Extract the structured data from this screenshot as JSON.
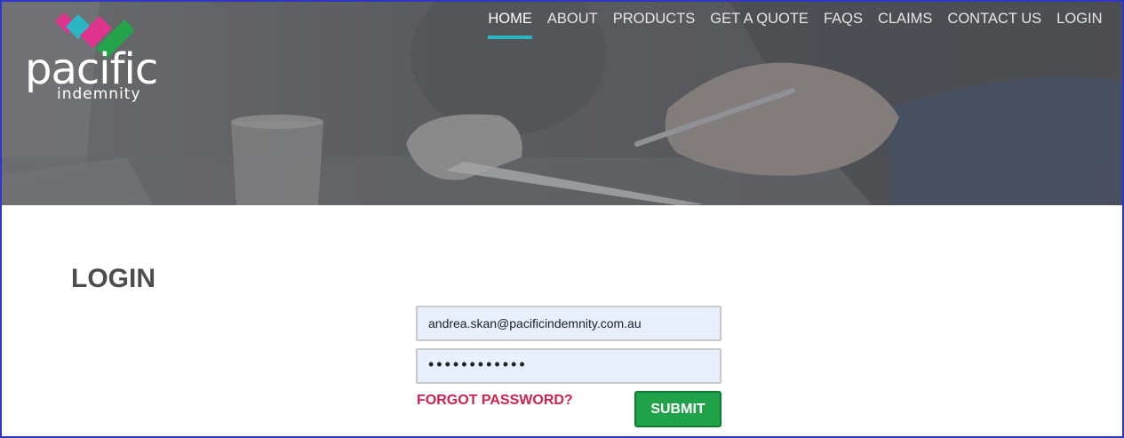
{
  "brand": {
    "name": "pacific",
    "subname": "indemnity",
    "colors": {
      "pink": "#e0338e",
      "teal": "#2cb5c4",
      "green": "#23a34a"
    }
  },
  "nav": {
    "items": [
      {
        "label": "HOME",
        "active": true
      },
      {
        "label": "ABOUT"
      },
      {
        "label": "PRODUCTS"
      },
      {
        "label": "GET A QUOTE"
      },
      {
        "label": "FAQS"
      },
      {
        "label": "CLAIMS"
      },
      {
        "label": "CONTACT US"
      },
      {
        "label": "LOGIN"
      }
    ]
  },
  "login": {
    "title": "LOGIN",
    "email_value": "andrea.skan@pacificindemnity.com.au",
    "password_mask": "••••••••••••",
    "forgot_label": "FORGOT PASSWORD?",
    "submit_label": "SUBMIT"
  }
}
